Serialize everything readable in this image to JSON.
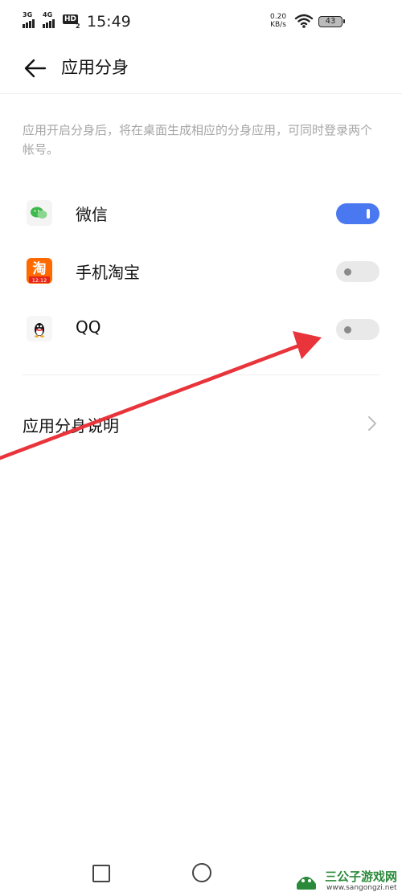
{
  "status_bar": {
    "sim1": "3G",
    "sim2": "4G",
    "hd": "HD",
    "hd_sub": "2",
    "time": "15:49",
    "speed_value": "0.20",
    "speed_unit": "KB/s",
    "battery": "43",
    "wifi_icon": "wifi-icon"
  },
  "header": {
    "title": "应用分身",
    "back_icon": "arrow-left-icon"
  },
  "description": "应用开启分身后，将在桌面生成相应的分身应用，可同时登录两个帐号。",
  "apps": [
    {
      "name": "微信",
      "icon": "wechat-icon",
      "enabled": true
    },
    {
      "name": "手机淘宝",
      "icon": "taobao-icon",
      "icon_text": "淘",
      "icon_sub": "12.12",
      "enabled": false
    },
    {
      "name": "QQ",
      "icon": "qq-icon",
      "enabled": false
    }
  ],
  "info_row": {
    "label": "应用分身说明",
    "chevron_icon": "chevron-right-icon"
  },
  "colors": {
    "toggle_on": "#4a78f0",
    "toggle_off": "#e9e9e9",
    "annotation_arrow": "#e8343a",
    "description_text": "#a6a6a6"
  },
  "nav_bar": {
    "recent_icon": "square-icon",
    "home_icon": "circle-icon"
  },
  "watermark": {
    "name": "三公子游戏网",
    "url": "www.sangongzi.net"
  }
}
